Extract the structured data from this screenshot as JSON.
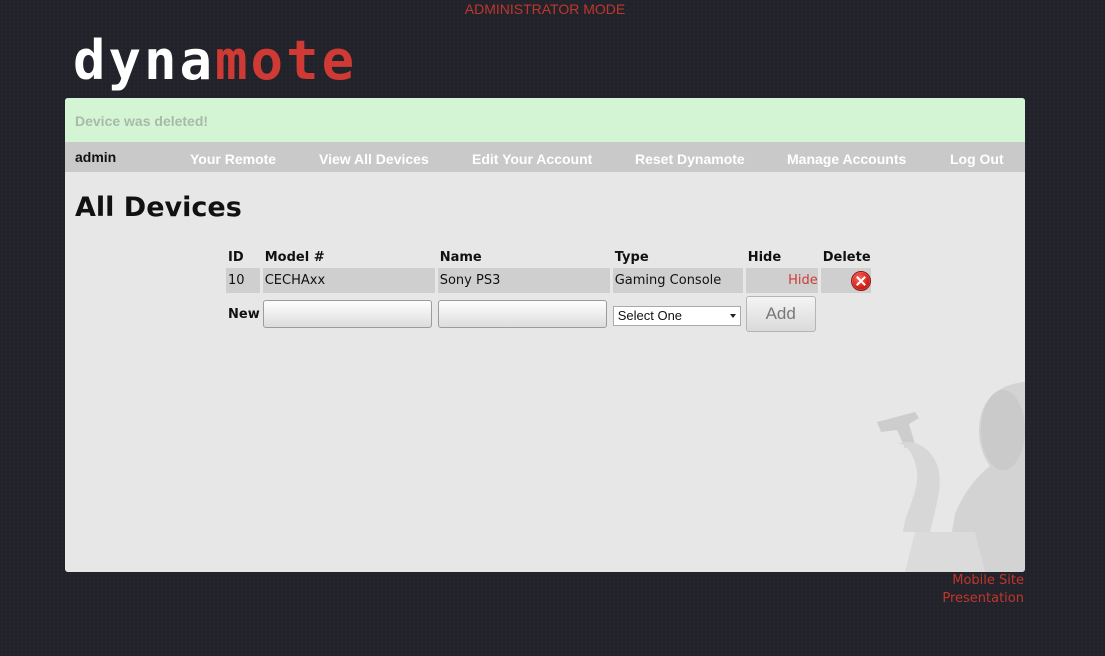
{
  "header": {
    "mode_label": "ADMINISTRATOR MODE",
    "logo_part1": "dyna",
    "logo_part2": "mote"
  },
  "flash": {
    "message": "Device was deleted!"
  },
  "nav": {
    "user": "admin",
    "items": [
      "Your Remote",
      "View All Devices",
      "Edit Your Account",
      "Reset Dynamote",
      "Manage Accounts",
      "Log Out"
    ]
  },
  "main": {
    "title": "All Devices",
    "table": {
      "columns": [
        "ID",
        "Model #",
        "Name",
        "Type",
        "Hide",
        "Delete"
      ],
      "rows": [
        {
          "id": "10",
          "model": "CECHAxx",
          "name": "Sony PS3",
          "type": "Gaming Console",
          "hide": "Hide"
        }
      ],
      "new_row": {
        "label": "New",
        "model_value": "",
        "name_value": "",
        "type_selected": "Select One",
        "add_label": "Add"
      }
    }
  },
  "footer": {
    "mobile_link": "Mobile Site",
    "presentation_link": "Presentation"
  },
  "colors": {
    "accent": "#c0362c",
    "flash_bg": "#d4f5d4",
    "panel_bg": "#e7e7e7",
    "nav_bg": "#c9c9c9"
  }
}
